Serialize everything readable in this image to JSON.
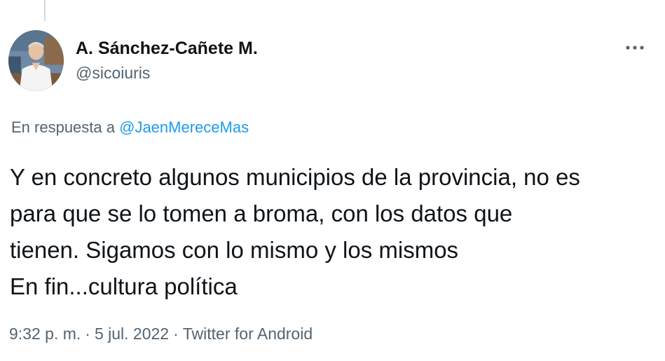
{
  "tweet": {
    "author": {
      "display_name": "A. Sánchez-Cañete M.",
      "handle": "@sicoiuris",
      "avatar_icon": "profile-photo"
    },
    "more_icon": "more-horizontal-icon",
    "reply_prefix": "En respuesta a",
    "reply_to": "@JaenMereceMas",
    "text_lines": [
      "Y en concreto algunos municipios de la provincia, no es",
      "para que se lo tomen a broma, con los datos que",
      "tienen. Sigamos con lo mismo y los mismos",
      "En fin...cultura política"
    ],
    "time": "9:32 p. m.",
    "date": "5 jul. 2022",
    "source": "Twitter for Android",
    "separator": "·"
  },
  "colors": {
    "text_primary": "#0f1419",
    "text_secondary": "#536471",
    "link": "#1d9bf0",
    "thread_line": "#cfd9de"
  }
}
